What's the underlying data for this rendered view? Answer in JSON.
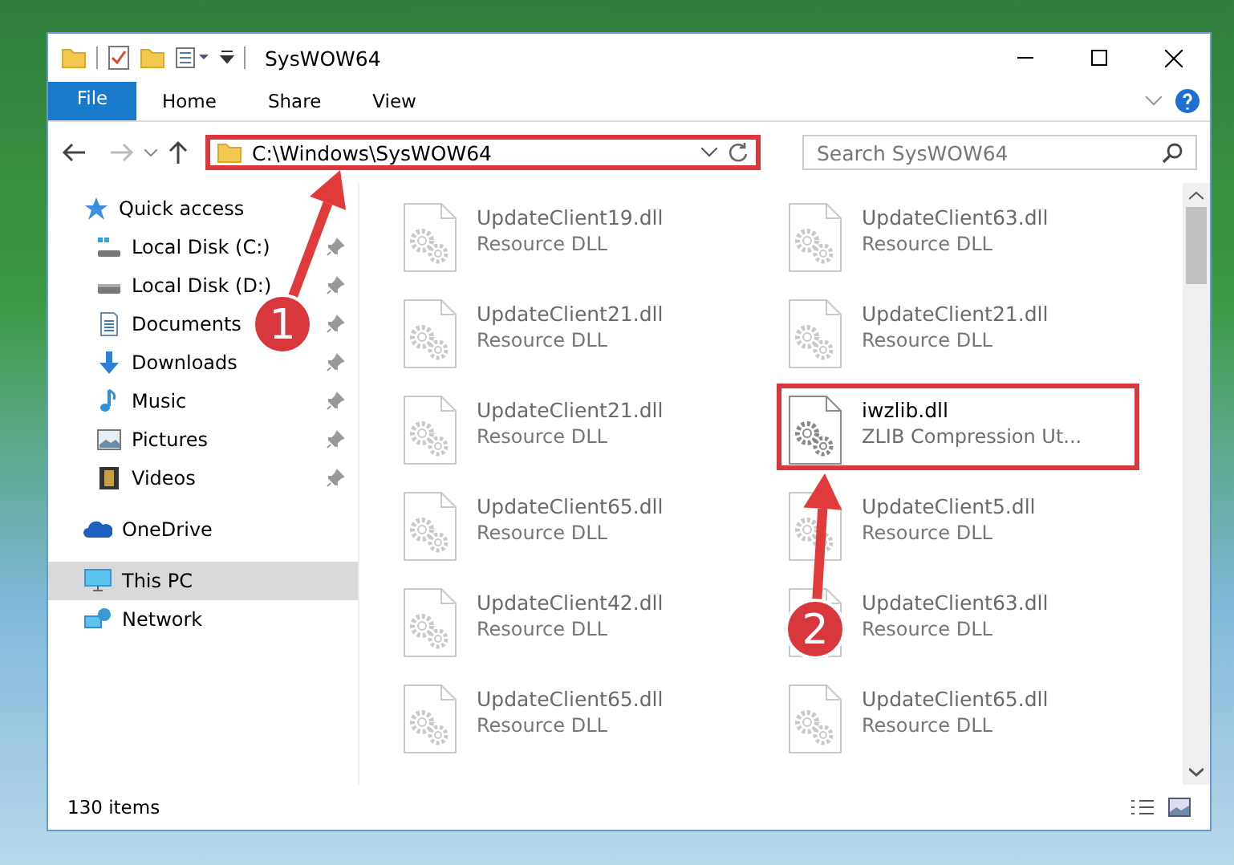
{
  "window": {
    "title": "SysWOW64"
  },
  "ribbon": {
    "tabs": [
      {
        "label": "File",
        "kind": "file",
        "selected": false
      },
      {
        "label": "Home",
        "kind": "tab",
        "selected": false
      },
      {
        "label": "Share",
        "kind": "tab",
        "selected": false
      },
      {
        "label": "View",
        "kind": "tab",
        "selected": false
      }
    ]
  },
  "address": {
    "path": "C:\\Windows\\SysWOW64",
    "highlighted": true
  },
  "search": {
    "placeholder": "Search SysWOW64"
  },
  "sidebar": {
    "items": [
      {
        "label": "Quick access",
        "kind": "star",
        "pinned": false,
        "selected": false,
        "children": [
          {
            "label": "Local Disk (C:)",
            "kind": "disk-c",
            "pinned": true,
            "selected": false
          },
          {
            "label": "Local Disk (D:)",
            "kind": "disk",
            "pinned": true,
            "selected": false
          },
          {
            "label": "Documents",
            "kind": "documents",
            "pinned": true,
            "selected": false
          },
          {
            "label": "Downloads",
            "kind": "downloads",
            "pinned": true,
            "selected": false
          },
          {
            "label": "Music",
            "kind": "music",
            "pinned": true,
            "selected": false
          },
          {
            "label": "Pictures",
            "kind": "pictures",
            "pinned": true,
            "selected": false
          },
          {
            "label": "Videos",
            "kind": "videos",
            "pinned": true,
            "selected": false
          }
        ]
      },
      {
        "label": "OneDrive",
        "kind": "cloud",
        "pinned": false,
        "selected": false
      },
      {
        "label": "This PC",
        "kind": "pc",
        "pinned": false,
        "selected": true
      },
      {
        "label": "Network",
        "kind": "network",
        "pinned": false,
        "selected": false
      }
    ]
  },
  "files": [
    {
      "name": "UpdateClient19.dll",
      "type": "Resource DLL",
      "blurred": true,
      "highlighted": false
    },
    {
      "name": "UpdateClient63.dll",
      "type": "Resource DLL",
      "blurred": true,
      "highlighted": false
    },
    {
      "name": "UpdateClient21.dll",
      "type": "Resource DLL",
      "blurred": true,
      "highlighted": false
    },
    {
      "name": "UpdateClient21.dll",
      "type": "Resource DLL",
      "blurred": true,
      "highlighted": false
    },
    {
      "name": "UpdateClient21.dll",
      "type": "Resource DLL",
      "blurred": true,
      "highlighted": false
    },
    {
      "name": "iwzlib.dll",
      "type": "ZLIB Compression Ut...",
      "blurred": false,
      "highlighted": true
    },
    {
      "name": "UpdateClient65.dll",
      "type": "Resource DLL",
      "blurred": true,
      "highlighted": false
    },
    {
      "name": "UpdateClient5.dll",
      "type": "Resource DLL",
      "blurred": true,
      "highlighted": false
    },
    {
      "name": "UpdateClient42.dll",
      "type": "Resource DLL",
      "blurred": true,
      "highlighted": false
    },
    {
      "name": "UpdateClient63.dll",
      "type": "Resource DLL",
      "blurred": true,
      "highlighted": false
    },
    {
      "name": "UpdateClient65.dll",
      "type": "Resource DLL",
      "blurred": true,
      "highlighted": false
    },
    {
      "name": "UpdateClient65.dll",
      "type": "Resource DLL",
      "blurred": true,
      "highlighted": false
    }
  ],
  "status_bar": {
    "count": "130 items"
  },
  "annotations": [
    {
      "label": "1"
    },
    {
      "label": "2"
    }
  ]
}
